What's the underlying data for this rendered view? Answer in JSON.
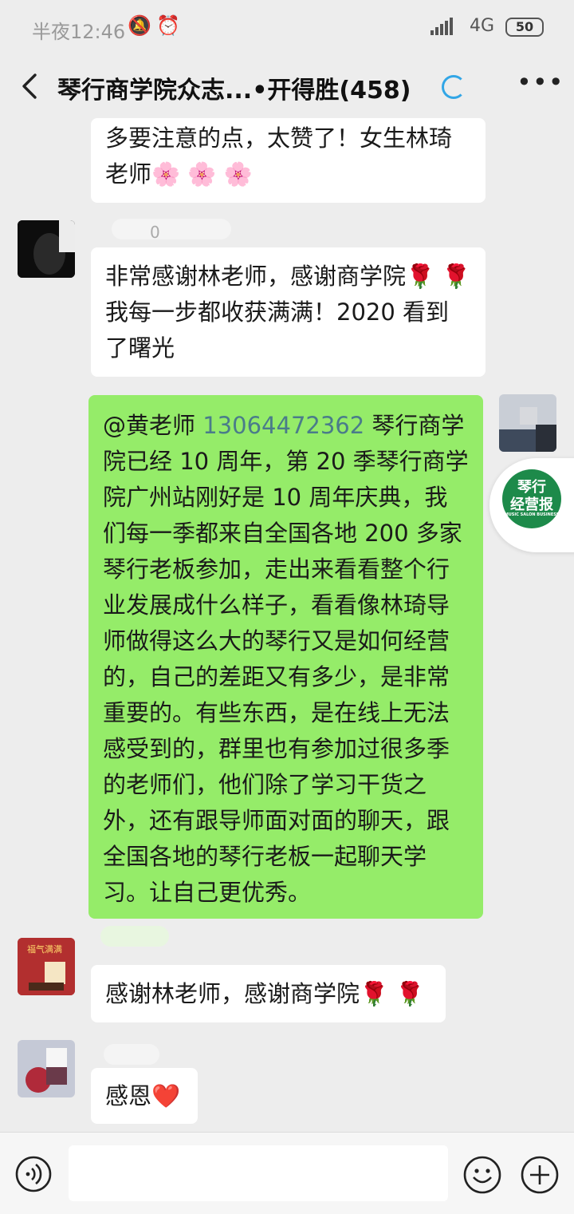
{
  "status_bar": {
    "time": "半夜12:46",
    "network": "4G",
    "battery": "50"
  },
  "nav": {
    "title": "琴行商学院众志...•开得胜(458)"
  },
  "messages": [
    {
      "side": "left",
      "text": "多要注意的点，太赞了！女生林琦老师🌸 🌸 🌸"
    },
    {
      "side": "left",
      "sender_fragment": "0",
      "text": "非常感谢林老师，感谢商学院🌹 🌹我每一步都收获满满！2020 看到了曙光"
    },
    {
      "side": "right",
      "mention": "@黄老师",
      "phone": "13064472362",
      "text": " 琴行商学院已经 10 周年，第 20 季琴行商学院广州站刚好是 10 周年庆典，我们每一季都来自全国各地 200 多家琴行老板参加，走出来看看整个行业发展成什么样子，看看像林琦导师做得这么大的琴行又是如何经营的，自己的差距又有多少，是非常重要的。有些东西，是在线上无法感受到的，群里也有参加过很多季的老师们，他们除了学习干货之外，还有跟导师面对面的聊天，跟全国各地的琴行老板一起聊天学习。让自己更优秀。"
    },
    {
      "side": "left",
      "avatar_text": "福气满满",
      "text": "感谢林老师，感谢商学院🌹 🌹"
    },
    {
      "side": "left",
      "text": "感恩❤️"
    }
  ],
  "badge": {
    "line1": "琴行",
    "line2": "经营报",
    "line3": "MUSIC SALON BUSINESS"
  },
  "input_bar": {
    "placeholder": ""
  },
  "colors": {
    "background": "#ededed",
    "my_bubble": "#95ec69",
    "their_bubble": "#ffffff",
    "badge_green": "#1d8a4a"
  },
  "icons": [
    "back-arrow-icon",
    "loading-icon",
    "more-icon",
    "voice-icon",
    "emoji-icon",
    "plus-icon"
  ]
}
